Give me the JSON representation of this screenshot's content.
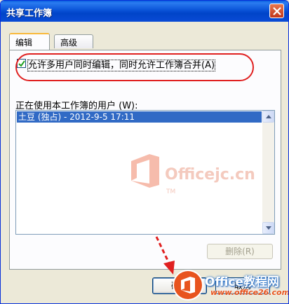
{
  "window": {
    "title": "共享工作簿"
  },
  "tabs": [
    {
      "label": "编辑",
      "active": true
    },
    {
      "label": "高级",
      "active": false
    }
  ],
  "edit_tab": {
    "allow_multi_user_checkbox": {
      "label_prefix": "允许多用户同时编辑，同时允许工作簿合并",
      "accelerator": "(A)",
      "checked": true
    },
    "users_list_label": "正在使用本工作簿的用户 (W):",
    "users": [
      "土豆 (独占) - 2012-9-5 17:11"
    ],
    "remove_button_label": "删除(R)",
    "remove_button_enabled": false
  },
  "footer": {
    "ok_button_label": "确定",
    "cancel_button_label": "取消"
  },
  "watermarks": {
    "center_text": "Officejc.cn",
    "center_tm": "TM",
    "brand_title": "Office教程网",
    "brand_url": "www.office26.com"
  },
  "colors": {
    "titlebar": "#0a53d8",
    "selection": "#316ac5",
    "annotation_red": "#e02020",
    "brand_orange": "#e8541e"
  },
  "icons": [
    "close-icon",
    "checkmark-icon",
    "scroll-up-arrow-icon",
    "scroll-down-arrow-icon",
    "office-logo-icon",
    "dashed-arrow-icon"
  ]
}
